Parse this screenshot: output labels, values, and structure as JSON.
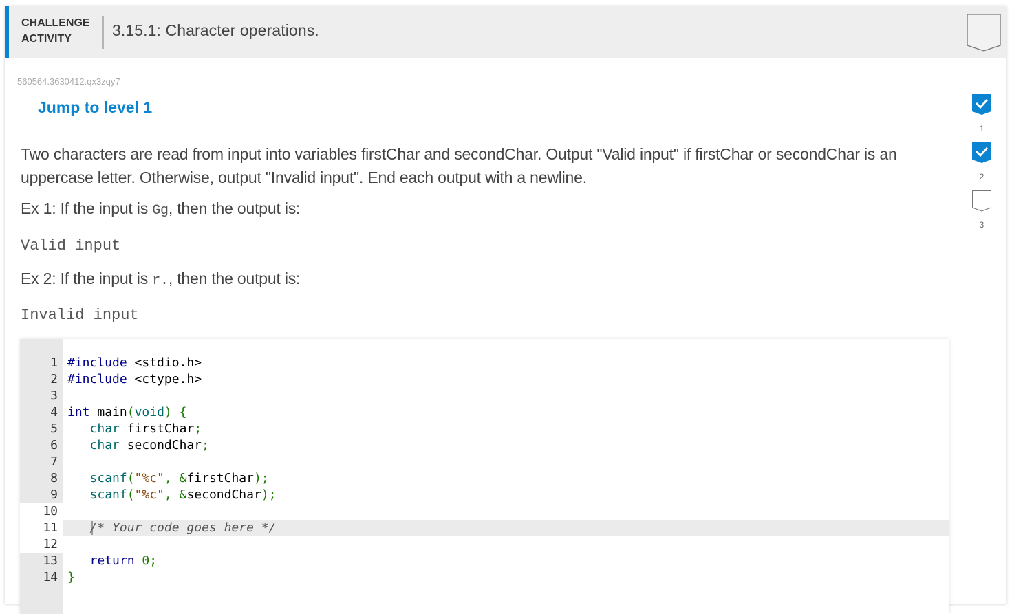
{
  "header": {
    "label_line1": "CHALLENGE",
    "label_line2": "ACTIVITY",
    "title": "3.15.1: Character operations.",
    "badge_icon": "completion-badge-icon"
  },
  "activity_id": "560564.3630412.qx3zqy7",
  "jump_link": "Jump to level 1",
  "prompt": {
    "paragraph": "Two characters are read from input into variables firstChar and secondChar. Output \"Valid input\" if firstChar or secondChar is an uppercase letter. Otherwise, output \"Invalid input\". End each output with a newline.",
    "ex1_prefix": "Ex 1: If the input is ",
    "ex1_input": "Gg",
    "ex1_suffix": ", then the output is:",
    "ex1_output": "Valid input",
    "ex2_prefix": "Ex 2: If the input is ",
    "ex2_input": "r.",
    "ex2_suffix": ", then the output is:",
    "ex2_output": "Invalid input"
  },
  "editor": {
    "lines": [
      {
        "num": "1",
        "code": "#include <stdio.h>"
      },
      {
        "num": "2",
        "code": "#include <ctype.h>"
      },
      {
        "num": "3",
        "code": ""
      },
      {
        "num": "4",
        "code": "int main(void) {"
      },
      {
        "num": "5",
        "code": "   char firstChar;"
      },
      {
        "num": "6",
        "code": "   char secondChar;"
      },
      {
        "num": "7",
        "code": ""
      },
      {
        "num": "8",
        "code": "   scanf(\"%c\", &firstChar);"
      },
      {
        "num": "9",
        "code": "   scanf(\"%c\", &secondChar);"
      },
      {
        "num": "10",
        "code": ""
      },
      {
        "num": "11",
        "code": "   /* Your code goes here */"
      },
      {
        "num": "12",
        "code": ""
      },
      {
        "num": "13",
        "code": "   return 0;"
      },
      {
        "num": "14",
        "code": "}"
      }
    ],
    "editable_lines": [
      "10",
      "11",
      "12"
    ],
    "active_line": "11"
  },
  "levels": [
    {
      "num": "1",
      "status": "completed"
    },
    {
      "num": "2",
      "status": "completed"
    },
    {
      "num": "3",
      "status": "incomplete"
    }
  ],
  "colors": {
    "accent": "#0a84d0",
    "header_bg": "#eeeeee",
    "gutter_bg": "#e8e8e8"
  }
}
